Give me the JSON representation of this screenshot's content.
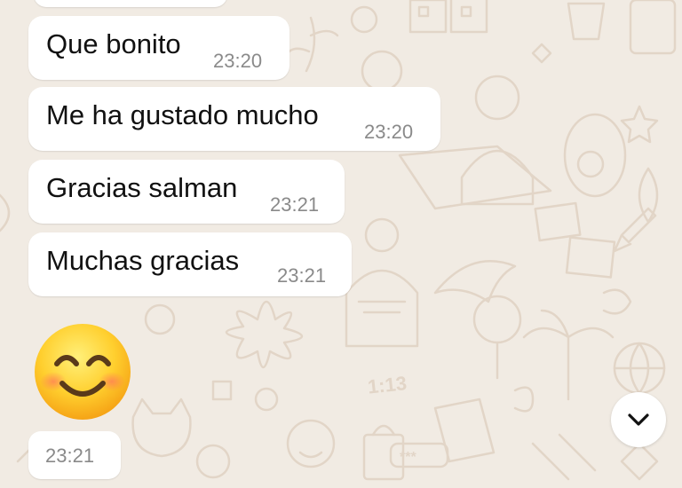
{
  "chat": {
    "messages": [
      {
        "text": "Que bonito",
        "time": "23:20"
      },
      {
        "text": "Me ha gustado mucho",
        "time": "23:20"
      },
      {
        "text": "Gracias salman",
        "time": "23:21"
      },
      {
        "text": "Muchas gracias",
        "time": "23:21"
      }
    ],
    "emoji_message": {
      "emoji": "smiling-face-with-smiling-eyes",
      "time": "23:21"
    }
  },
  "wallpaper": {
    "doodle_clock_text": "1:13",
    "doodle_password_text": "***"
  },
  "icons": {
    "scroll_down": "chevron-down-icon"
  },
  "colors": {
    "background": "#f1ebe3",
    "bubble": "#ffffff",
    "text": "#111111",
    "timestamp": "#8a8a8a",
    "doodle": "#e2d5c7"
  }
}
